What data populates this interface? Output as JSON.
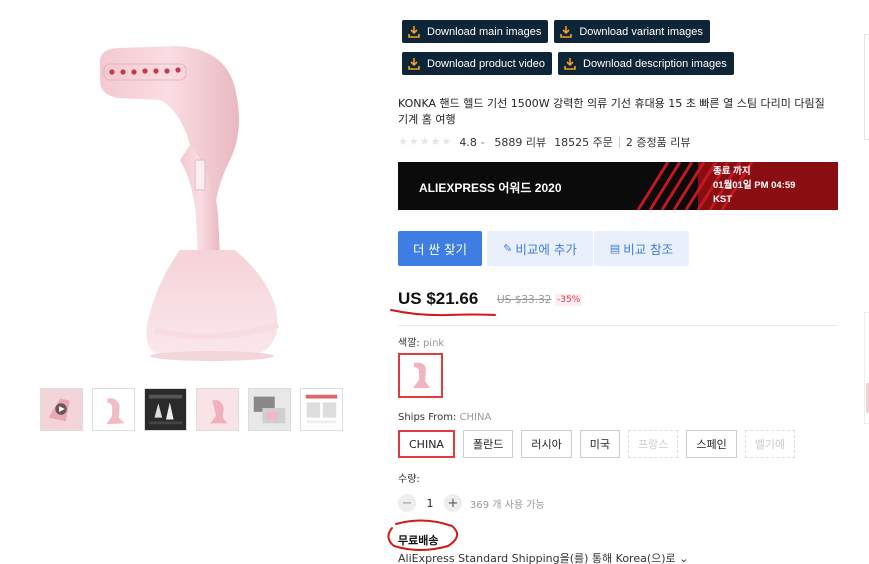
{
  "gallery": {
    "main_image_alt": "pink handheld garment steamer",
    "thumbnails": [
      "video-thumb",
      "steamer-side",
      "steamer-dark",
      "steamer-pink",
      "steamer-detail",
      "steamer-package"
    ]
  },
  "downloads": {
    "main_images": "Download main images",
    "variant_images": "Download variant images",
    "product_video": "Download product video",
    "description_images": "Download description images"
  },
  "product": {
    "title": "KONKA 핸드 헬드 기선 1500W 강력한 의류 기선 휴대용 15 초 빠른 열 스팀 다리미 다림질 기계 홈 여행",
    "rating": "4.8",
    "reviews": "5889 리뷰",
    "orders": "18525 주문",
    "extra_reviews": "2 증정품 리뷰"
  },
  "banner": {
    "title": "ALIEXPRESS 어워드 2020",
    "ends_label": "종료 까지",
    "ends_time": "01월01일 PM 04:59",
    "timezone": "KST"
  },
  "actions": {
    "find_cheaper": "더 싼 찾기",
    "add_compare": "비교에 추가",
    "view_compare": "비교 참조"
  },
  "price": {
    "current": "US $21.66",
    "original": "US $33.32",
    "discount": "-35%"
  },
  "color": {
    "label": "색깔: ",
    "value": "pink"
  },
  "ships_from": {
    "label": "Ships From: ",
    "value": "CHINA",
    "options": [
      {
        "label": "CHINA",
        "state": "selected"
      },
      {
        "label": "폴란드",
        "state": "normal"
      },
      {
        "label": "러시아",
        "state": "normal"
      },
      {
        "label": "미국",
        "state": "normal"
      },
      {
        "label": "프랑스",
        "state": "disabled"
      },
      {
        "label": "스페인",
        "state": "normal"
      },
      {
        "label": "벨기에",
        "state": "disabled"
      }
    ]
  },
  "quantity": {
    "label": "수량:",
    "value": "1",
    "minus": "−",
    "plus": "+",
    "available": "369 개 사용 가능"
  },
  "shipping": {
    "free": "무료배송",
    "method": "AliExpress Standard Shipping을(를) 통해 Korea(으)로 ⌄"
  },
  "colors": {
    "accent_blue": "#3e7de3",
    "download_bg": "#0d2536",
    "annotation_red": "#d11a1a",
    "select_red": "#e03b3b"
  }
}
